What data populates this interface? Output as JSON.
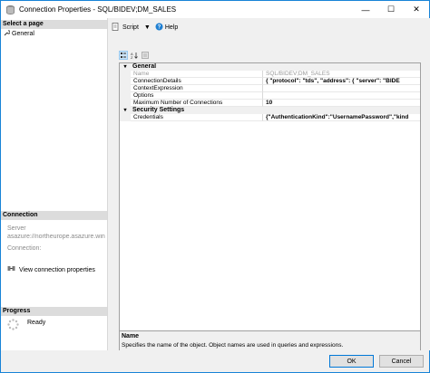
{
  "window": {
    "title": "Connection Properties - SQL/BIDEV;DM_SALES"
  },
  "left": {
    "select_page_header": "Select a page",
    "pages": [
      {
        "label": "General"
      }
    ],
    "connection_header": "Connection",
    "server_label": "Server",
    "server_value": "asazure://northeurope.asazure.win",
    "connection_label": "Connection:",
    "view_connection_link": "View connection properties",
    "progress_header": "Progress",
    "progress_status": "Ready"
  },
  "toolbar": {
    "script_label": "Script",
    "help_label": "Help"
  },
  "grid": {
    "categories": [
      {
        "name": "General",
        "rows": [
          {
            "name": "Name",
            "value": "SQL/BIDEV;DM_SALES",
            "disabled": true
          },
          {
            "name": "ConnectionDetails",
            "value": "{  \"protocol\": \"tds\",  \"address\": {    \"server\": \"BIDE",
            "disabled": false
          },
          {
            "name": "ContextExpression",
            "value": "",
            "disabled": false
          },
          {
            "name": "Options",
            "value": "",
            "disabled": false
          },
          {
            "name": "Maximum Number of Connections",
            "value": "10",
            "disabled": false
          }
        ]
      },
      {
        "name": "Security Settings",
        "rows": [
          {
            "name": "Credentials",
            "value": "{\"AuthenticationKind\":\"UsernamePassword\",\"kind",
            "disabled": false
          }
        ]
      }
    ]
  },
  "description": {
    "title": "Name",
    "text": "Specifies the name of the object. Object names are used in queries and expressions."
  },
  "footer": {
    "ok_label": "OK",
    "cancel_label": "Cancel"
  }
}
